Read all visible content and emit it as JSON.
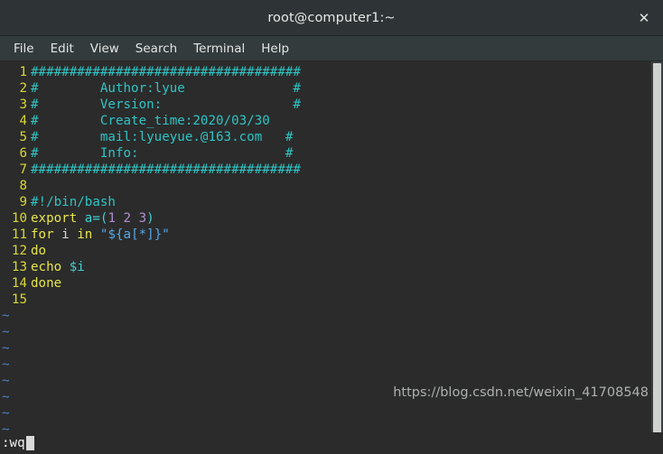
{
  "window": {
    "title": "root@computer1:~",
    "close_label": "✕"
  },
  "menubar": {
    "items": [
      {
        "label": "File"
      },
      {
        "label": "Edit"
      },
      {
        "label": "View"
      },
      {
        "label": "Search"
      },
      {
        "label": "Terminal"
      },
      {
        "label": "Help"
      }
    ]
  },
  "editor": {
    "lines": [
      {
        "num": "1",
        "text": "###################################"
      },
      {
        "num": "2",
        "text": "#        Author:lyue              #"
      },
      {
        "num": "3",
        "text": "#        Version:                 #"
      },
      {
        "num": "4",
        "text": "#        Create_time:2020/03/30"
      },
      {
        "num": "5",
        "text": "#        mail:lyueyue.@163.com   #"
      },
      {
        "num": "6",
        "text": "#        Info:                   #"
      },
      {
        "num": "7",
        "text": "###################################"
      },
      {
        "num": "8",
        "text": ""
      },
      {
        "num": "9",
        "text": "#!/bin/bash"
      },
      {
        "num": "10",
        "text": "export a=(1 2 3)"
      },
      {
        "num": "11",
        "text": "for i in \"${a[*]}\""
      },
      {
        "num": "12",
        "text": "do"
      },
      {
        "num": "13",
        "text": "echo $i"
      },
      {
        "num": "14",
        "text": "done"
      },
      {
        "num": "15",
        "text": ""
      }
    ],
    "empty_marker": "~",
    "empty_marker_count": 8
  },
  "statusline": {
    "command": ":wq"
  },
  "watermark": {
    "text": "https://blog.csdn.net/weixin_41708548"
  },
  "colors": {
    "background": "#2b2b2b",
    "titlebar": "#2e3436",
    "menubar": "#333b3d",
    "line_number": "#d7d736",
    "comment": "#2fc4c4",
    "keyword": "#e6e64d",
    "variable": "#3fd0d0",
    "number": "#b08fd0",
    "string": "#54a7e8",
    "tilde": "#4f7fbf",
    "scrollbar_thumb": "#cfd2cf"
  }
}
